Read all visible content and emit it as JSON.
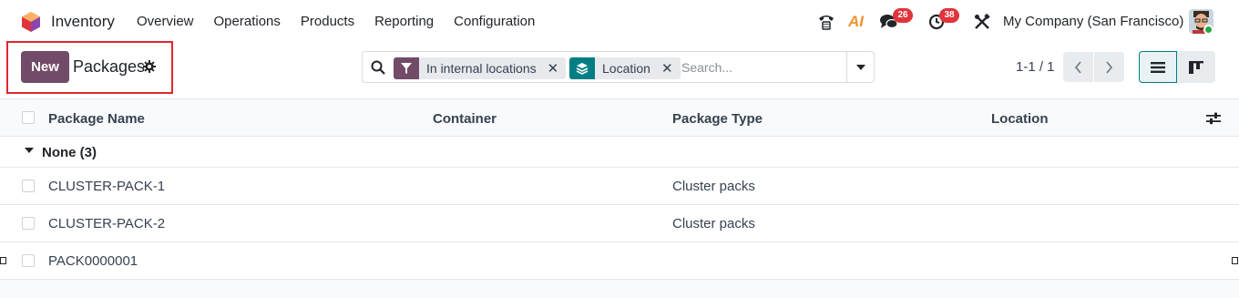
{
  "navbar": {
    "app_name": "Inventory",
    "menu": [
      "Overview",
      "Operations",
      "Products",
      "Reporting",
      "Configuration"
    ],
    "messages_badge": "26",
    "activities_badge": "38",
    "company": "My Company (San Francisco)",
    "ai_label": "AI"
  },
  "control_panel": {
    "new_label": "New",
    "title": "Packages",
    "search": {
      "facets": [
        {
          "label": "In internal locations",
          "icon": "filter-icon",
          "color": "#714b67"
        },
        {
          "label": "Location",
          "icon": "layers-icon",
          "color": "#017e84"
        }
      ],
      "placeholder": "Search..."
    },
    "pager": "1-1 / 1"
  },
  "list": {
    "columns": [
      "Package Name",
      "Container",
      "Package Type",
      "Location"
    ],
    "group": {
      "label": "None (3)"
    },
    "rows": [
      {
        "name": "CLUSTER-PACK-1",
        "container": "",
        "package_type": "Cluster packs",
        "location": ""
      },
      {
        "name": "CLUSTER-PACK-2",
        "container": "",
        "package_type": "Cluster packs",
        "location": ""
      },
      {
        "name": "PACK0000001",
        "container": "",
        "package_type": "",
        "location": ""
      }
    ]
  },
  "colors": {
    "brand": "#714b67",
    "teal": "#017e84",
    "badge": "#e0343b",
    "highlight": "#e0262f"
  }
}
